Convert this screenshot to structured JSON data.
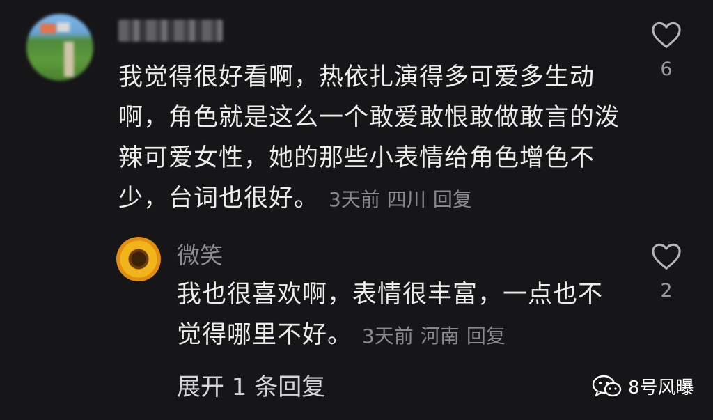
{
  "comment": {
    "text": "我觉得很好看啊，热依扎演得多可爱多生动啊，角色就是这么一个敢爱敢恨敢做敢言的泼辣可爱女性，她的那些小表情给角色增色不少，台词也很好。",
    "time": "3天前",
    "location": "四川",
    "reply_label": "回复",
    "likes": "6"
  },
  "reply": {
    "username": "微笑",
    "text": "我也很喜欢啊，表情很丰富，一点也不觉得哪里不好。",
    "time": "3天前",
    "location": "河南",
    "reply_label": "回复",
    "likes": "2"
  },
  "expand_label": "展开 1 条回复",
  "watermark": "8号风曝",
  "icons": {
    "like": "heart-outline-icon",
    "watermark": "wechat-icon"
  },
  "colors": {
    "background": "#161618",
    "text": "#ececec",
    "meta": "#8a8a8e"
  }
}
